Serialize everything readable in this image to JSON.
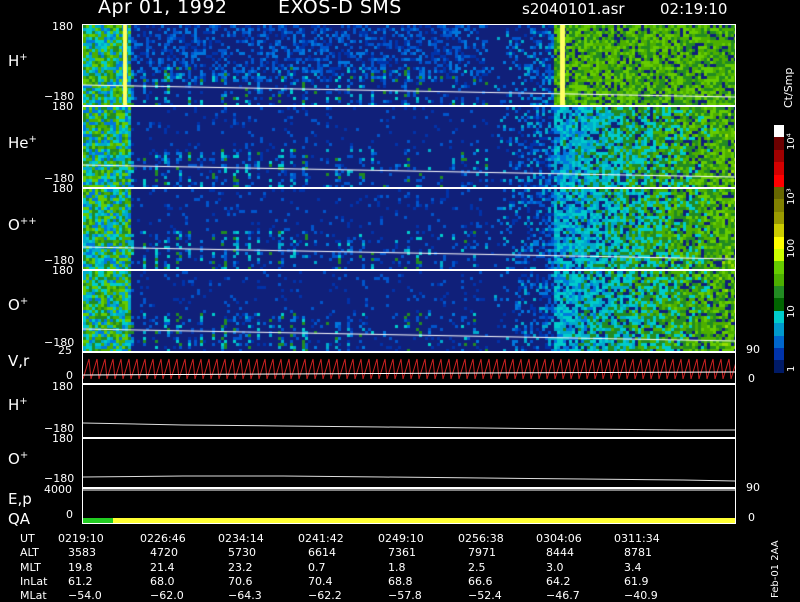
{
  "header": {
    "date": "Apr 01, 1992",
    "instrument": "EXOS-D SMS",
    "file": "s2040101.asr",
    "time": "02:19:10"
  },
  "colorbar": {
    "unit": "Ct/Smp",
    "ticks": [
      "10⁴",
      "10³",
      "100",
      "10",
      "1"
    ],
    "colors": [
      "#ffffff",
      "#6b0000",
      "#a00000",
      "#d40000",
      "#ff0000",
      "#666600",
      "#808000",
      "#9a9a00",
      "#cccc00",
      "#ffff00",
      "#ccff00",
      "#66cc00",
      "#4caf00",
      "#228b22",
      "#006400",
      "#00cccc",
      "#0099cc",
      "#0066cc",
      "#0033aa",
      "#001a66"
    ]
  },
  "panels": [
    {
      "id": "h",
      "label": "H",
      "sup": "+",
      "ytop": "180",
      "ybot": "−180"
    },
    {
      "id": "he",
      "label": "He",
      "sup": "+",
      "ytop": "180",
      "ybot": "−180"
    },
    {
      "id": "opp",
      "label": "O",
      "sup": "++",
      "ytop": "180",
      "ybot": "−180"
    },
    {
      "id": "op",
      "label": "O",
      "sup": "+",
      "ytop": "180",
      "ybot": "−180"
    }
  ],
  "vr_panel": {
    "label": "V,r",
    "ytop": "25",
    "ybot": "0",
    "rtop": "90",
    "rbot": "0"
  },
  "h_line_panel": {
    "label": "H",
    "sup": "+",
    "ytop": "180",
    "ybot": "−180"
  },
  "o_line_panel": {
    "label": "O",
    "sup": "+",
    "ytop": "180",
    "ybot": "−180"
  },
  "ep_panel": {
    "label": "E,p",
    "ytop": "4000",
    "rtop": "90"
  },
  "qa_panel": {
    "label": "QA",
    "ybot": "0",
    "rbot": "0"
  },
  "table": {
    "labels": [
      "UT",
      "ALT",
      "MLT",
      "InLat",
      "MLat"
    ],
    "columns": [
      [
        "0219:10",
        "3583",
        "19.8",
        "61.2",
        "−54.0"
      ],
      [
        "0226:46",
        "4720",
        "21.4",
        "68.0",
        "−62.0"
      ],
      [
        "0234:14",
        "5730",
        "23.2",
        "70.6",
        "−64.3"
      ],
      [
        "0241:42",
        "6614",
        "0.7",
        "70.4",
        "−62.2"
      ],
      [
        "0249:10",
        "7361",
        "1.8",
        "68.8",
        "−57.8"
      ],
      [
        "0256:38",
        "7971",
        "2.5",
        "66.6",
        "−52.4"
      ],
      [
        "0304:06",
        "8444",
        "3.0",
        "64.2",
        "−46.7"
      ],
      [
        "0311:34",
        "8781",
        "3.4",
        "61.9",
        "−40.9"
      ]
    ]
  },
  "footer_note": "Feb-01 2AA",
  "chart_data": {
    "type": "heatmap",
    "title": "Apr 01, 1992   EXOS-D SMS",
    "x": [
      "0219:10",
      "0226:46",
      "0234:14",
      "0241:42",
      "0249:10",
      "0256:38",
      "0304:06",
      "0311:34"
    ],
    "series": [
      {
        "name": "H+",
        "ylim": [
          -180,
          180
        ]
      },
      {
        "name": "He+",
        "ylim": [
          -180,
          180
        ]
      },
      {
        "name": "O++",
        "ylim": [
          -180,
          180
        ]
      },
      {
        "name": "O+",
        "ylim": [
          -180,
          180
        ]
      }
    ],
    "colorbar_unit": "Ct/Smp",
    "colorbar_ticks": [
      "1",
      "10",
      "100",
      "10³",
      "10⁴"
    ]
  }
}
